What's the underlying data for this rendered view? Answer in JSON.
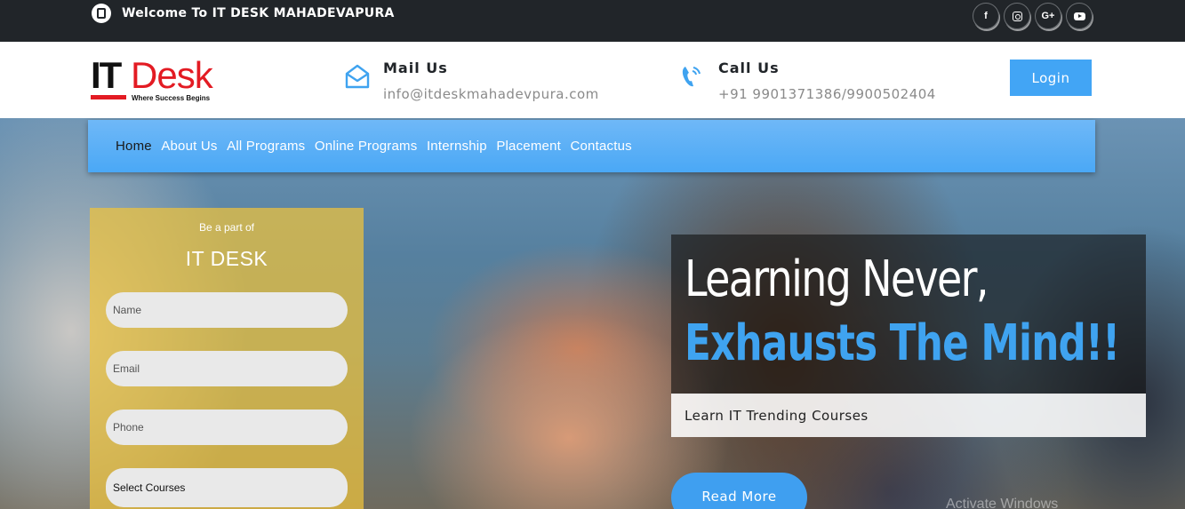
{
  "topbar": {
    "welcome": "Welcome To IT DESK MAHADEVAPURA",
    "socials": [
      {
        "name": "facebook",
        "glyph": "f"
      },
      {
        "name": "instagram",
        "glyph": ""
      },
      {
        "name": "google-plus",
        "glyph": "G+"
      },
      {
        "name": "youtube",
        "glyph": ""
      }
    ]
  },
  "header": {
    "logo": {
      "it": "IT",
      "desk": "Desk",
      "tagline": "Where Success Begins"
    },
    "mail": {
      "title": "Mail Us",
      "value": "info@itdeskmahadevpura.com"
    },
    "call": {
      "title": "Call Us",
      "value": "+91 9901371386/9900502404"
    },
    "login_label": "Login"
  },
  "nav": {
    "items": [
      "Home",
      "About Us",
      "All Programs",
      "Online Programs",
      "Internship",
      "Placement",
      "Contactus"
    ]
  },
  "form": {
    "subtitle": "Be a part of",
    "title": "IT DESK",
    "name_placeholder": "Name",
    "email_placeholder": "Email",
    "phone_placeholder": "Phone",
    "course_select": "Select Courses"
  },
  "hero": {
    "line1": "Learning Never,",
    "line2": "Exhausts The Mind!!",
    "subline": "Learn IT Trending Courses",
    "read_more": "Read More",
    "watermark": "Activate Windows"
  },
  "colors": {
    "accent": "#42a5f5",
    "topbar": "#212529",
    "brand_red": "#e31b23",
    "form_panel": "#f0c33c"
  }
}
